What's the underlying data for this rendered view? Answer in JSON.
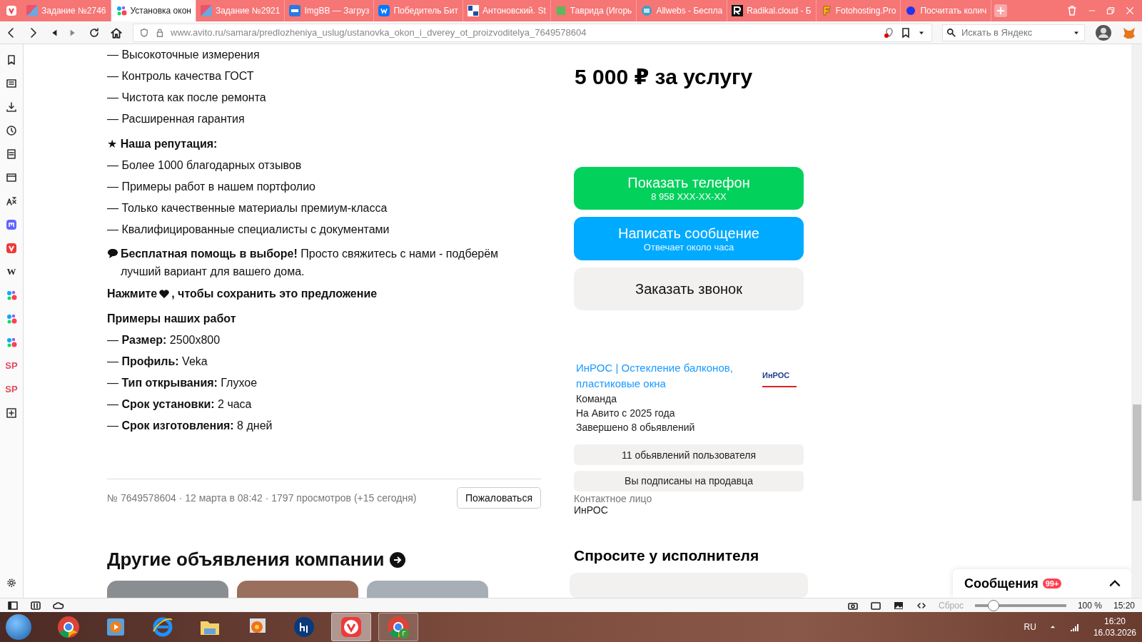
{
  "browser": {
    "tabs": [
      {
        "label": "Задание №2746",
        "selected": false
      },
      {
        "label": "Установка окон",
        "selected": true
      },
      {
        "label": "Задание №2921",
        "selected": false
      },
      {
        "label": "ImgBB — Загруз",
        "selected": false
      },
      {
        "label": "Победитель Бит",
        "selected": false
      },
      {
        "label": "Антоновский. St",
        "selected": false
      },
      {
        "label": "Таврида (Игорь",
        "selected": false
      },
      {
        "label": "Allwebs - Беспла",
        "selected": false
      },
      {
        "label": "Radikal.cloud - Б",
        "selected": false
      },
      {
        "label": "Fotohosting.Pro",
        "selected": false
      },
      {
        "label": "Посчитать колич",
        "selected": false
      }
    ],
    "url": "www.avito.ru/samara/predlozheniya_uslug/ustanovka_okon_i_dverey_ot_proizvoditelya_7649578604",
    "search_placeholder": "Искать в Яндекс"
  },
  "panel": {
    "items": [
      {
        "kind": "bookmark"
      },
      {
        "kind": "reader"
      },
      {
        "kind": "download"
      },
      {
        "kind": "history"
      },
      {
        "kind": "notes"
      },
      {
        "kind": "window"
      },
      {
        "kind": "translate"
      },
      {
        "kind": "mastodon"
      },
      {
        "kind": "vivaldi"
      },
      {
        "kind": "text",
        "label": "W"
      },
      {
        "kind": "dots"
      },
      {
        "kind": "dots"
      },
      {
        "kind": "dots"
      },
      {
        "kind": "text",
        "label": "SP"
      },
      {
        "kind": "text",
        "label": "SP"
      },
      {
        "kind": "add"
      }
    ]
  },
  "description": [
    {
      "kind": "line",
      "text": "— Высокоточные измерения"
    },
    {
      "kind": "line",
      "text": "— Контроль качества ГОСТ"
    },
    {
      "kind": "line",
      "text": "— Чистота как после ремонта"
    },
    {
      "kind": "line",
      "text": "— Расширенная гарантия"
    },
    {
      "kind": "heading",
      "text": "★ Наша репутация:"
    },
    {
      "kind": "line",
      "text": "— Более 1000 благодарных отзывов"
    },
    {
      "kind": "line",
      "text": "— Примеры работ в нашем портфолио"
    },
    {
      "kind": "line",
      "text": "— Только качественные материалы премиум-класса"
    },
    {
      "kind": "line",
      "text": "— Квалифицированные специалисты с документами"
    },
    {
      "kind": "chat",
      "text": "**Бесплатная помощь в выборе!** Просто свяжитесь с нами - подберём лучший вариант для вашего дома."
    },
    {
      "kind": "save",
      "text": "Нажмите",
      "text_after": ", чтобы сохранить это предложение"
    },
    {
      "kind": "heading",
      "text": "Примеры наших работ"
    },
    {
      "kind": "line",
      "text": "— **Размер:** 2500x800"
    },
    {
      "kind": "line",
      "text": "— **Профиль:** Veka"
    },
    {
      "kind": "line",
      "text": "— **Тип открывания:** Глухое"
    },
    {
      "kind": "line",
      "text": "— **Срок установки:** 2 часа"
    },
    {
      "kind": "line",
      "text": "— **Срок изготовления:** 8 дней"
    }
  ],
  "meta": "№ 7649578604 · 12 марта в 08:42 · 1797 просмотров (+15 сегодня)",
  "report_button": "Пожаловаться",
  "other_heading": "Другие объявления компании",
  "price": "5 000 ₽ за услугу",
  "actions": [
    {
      "kind": "green",
      "title": "Показать телефон",
      "subtitle": "8 958 XXX-XX-XX"
    },
    {
      "kind": "blue",
      "title": "Написать сообщение",
      "subtitle": "Отвечает около часа"
    },
    {
      "kind": "gray",
      "title": "Заказать звонок"
    }
  ],
  "seller": {
    "name": "ИнРОС | Остекление балконов, пластиковые окна",
    "logo": "ИнРОС",
    "details": [
      "Команда",
      "На Авито с 2025 года",
      "Завершено 8 обьявлений"
    ],
    "buttons": [
      "11 обьявлений пользователя",
      "Вы подписаны на продавца"
    ],
    "contact_label": "Контактное лицо",
    "contact_name": "ИнРОС"
  },
  "ask_heading": "Спросите у исполнителя",
  "messages": {
    "label": "Сообщения",
    "badge": "99+"
  },
  "status_bar": {
    "reset": "Сброс",
    "zoom": {
      "level": 0.2
    },
    "zoom_text": "100 %",
    "time": "15:20"
  },
  "taskbar": {
    "apps": [
      {
        "kind": "chrome",
        "running": false,
        "selected": false
      },
      {
        "kind": "media",
        "running": false,
        "selected": false
      },
      {
        "kind": "ie",
        "running": false,
        "selected": false
      },
      {
        "kind": "folder",
        "running": false,
        "selected": false
      },
      {
        "kind": "photos",
        "running": false,
        "selected": false
      },
      {
        "kind": "hp",
        "running": false,
        "selected": false
      },
      {
        "kind": "vivaldi",
        "running": true,
        "selected": true
      },
      {
        "kind": "chrome",
        "running": true,
        "selected": false,
        "badge": "Г"
      }
    ],
    "language": "RU",
    "time": "16:20",
    "date": "16.03.2026"
  }
}
